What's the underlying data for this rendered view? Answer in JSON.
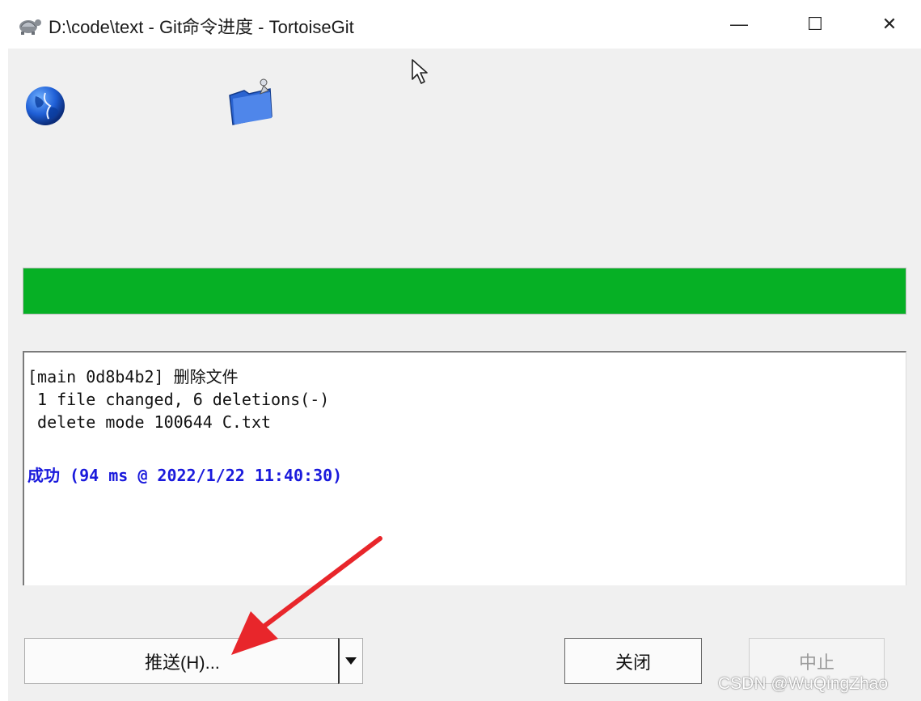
{
  "window": {
    "title": "D:\\code\\text - Git命令进度 - TortoiseGit",
    "app_icon": "tortoise-icon",
    "controls": {
      "minimize": "—",
      "maximize": "☐",
      "close": "✕"
    }
  },
  "icons": {
    "globe": "globe-icon",
    "folder": "folder-icon",
    "cursor": "mouse-pointer-icon"
  },
  "progress": {
    "fraction": 1.0,
    "color": "#06b025"
  },
  "log": {
    "line1": "[main 0d8b4b2] 删除文件",
    "line2": " 1 file changed, 6 deletions(-)",
    "line3": " delete mode 100644 C.txt",
    "success": "成功 (94 ms @ 2022/1/22 11:40:30)",
    "success_color": "#1a1adc"
  },
  "buttons": {
    "push_label": "推送(H)...",
    "dropdown_icon": "caret-down-icon",
    "close_label": "关闭",
    "stop_label": "中止"
  },
  "annotation": {
    "arrow_color": "#e8262b"
  },
  "watermark": "CSDN @WuQingZhao"
}
